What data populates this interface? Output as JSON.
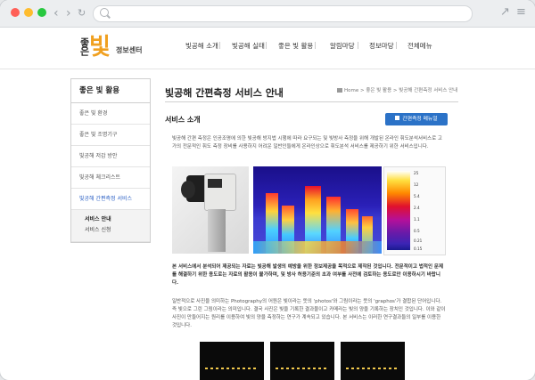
{
  "site": {
    "logo": {
      "mark1": "좋은",
      "mark2": "빛",
      "caption": "정보센터"
    },
    "gnb": [
      "빛공해 소개",
      "빛공해 실태",
      "좋은 빛 활용",
      "알림마당",
      "정보마당",
      "전체메뉴"
    ]
  },
  "sidebar": {
    "title": "좋은 빛 활용",
    "items": [
      {
        "label": "좋은 빛 환경"
      },
      {
        "label": "좋은 빛 조명기구"
      },
      {
        "label": "빛공해 저감 방안"
      },
      {
        "label": "빛공해 체크리스트"
      },
      {
        "label": "빛공해 간편측정 서비스"
      }
    ],
    "sub": [
      {
        "label": "서비스 안내"
      },
      {
        "label": "서비스 신청"
      }
    ]
  },
  "page": {
    "title": "빛공해 간편측정 서비스 안내",
    "breadcrumb": [
      "Home",
      "좋은 빛 활용",
      "빛공해 간편측정 서비스 안내"
    ],
    "section_title": "서비스 소개",
    "manual_button": "간편측정 메뉴얼",
    "para1": "빛공해 간편 측정은 인공조명에 의한 빛공해 방지법 시행에 따라 요구되는 및 빛방사 측정을 위해 개발된 온라인 휘도분석서비스로 고가의 전문적인 휘도 측정 장비를 사용하지 어려운 일반인들에게 온라인상으로 휘도분석 서비스를 제공하기 위한 서비스입니다.",
    "para2": "본 서비스에서 분석되어 제공되는 자료는 빛공해 발생의 예방을 위한 정보제공을 목적으로 제작된 것입니다. 전문적이고 법적인 문제를 해결하기 위한 용도로는 자료의 활용이 불가하며, 및 방사 허용기준의 초과 여부를 사전에 검토하는 용도로만 이용하시기 바랍니다.",
    "para3": "일반적으로 사진을 의미하는 Photography의 어원은 빛이라는 뜻의 'photos'와 그림이라는 뜻의 'graphos'가 결합된 단어입니다. 즉 빛으로 그린 그림이라는 의미입니다. 결국 사진은 빛을 기록한 결과물이고 카메라는 빛의 양을 기록하는 장치인 것입니다. 이와 같이 사진이 만들어지는 원리를 이용하여 빛의 양을 측정하는 연구가 계속되고 있습니다. 본 서비스는 이러한 연구결과들의 일부를 이용한 것입니다.",
    "scale_labels": [
      "25",
      "12",
      "5.4",
      "2.4",
      "1.1",
      "0.5",
      "0.21",
      "0.15"
    ]
  }
}
